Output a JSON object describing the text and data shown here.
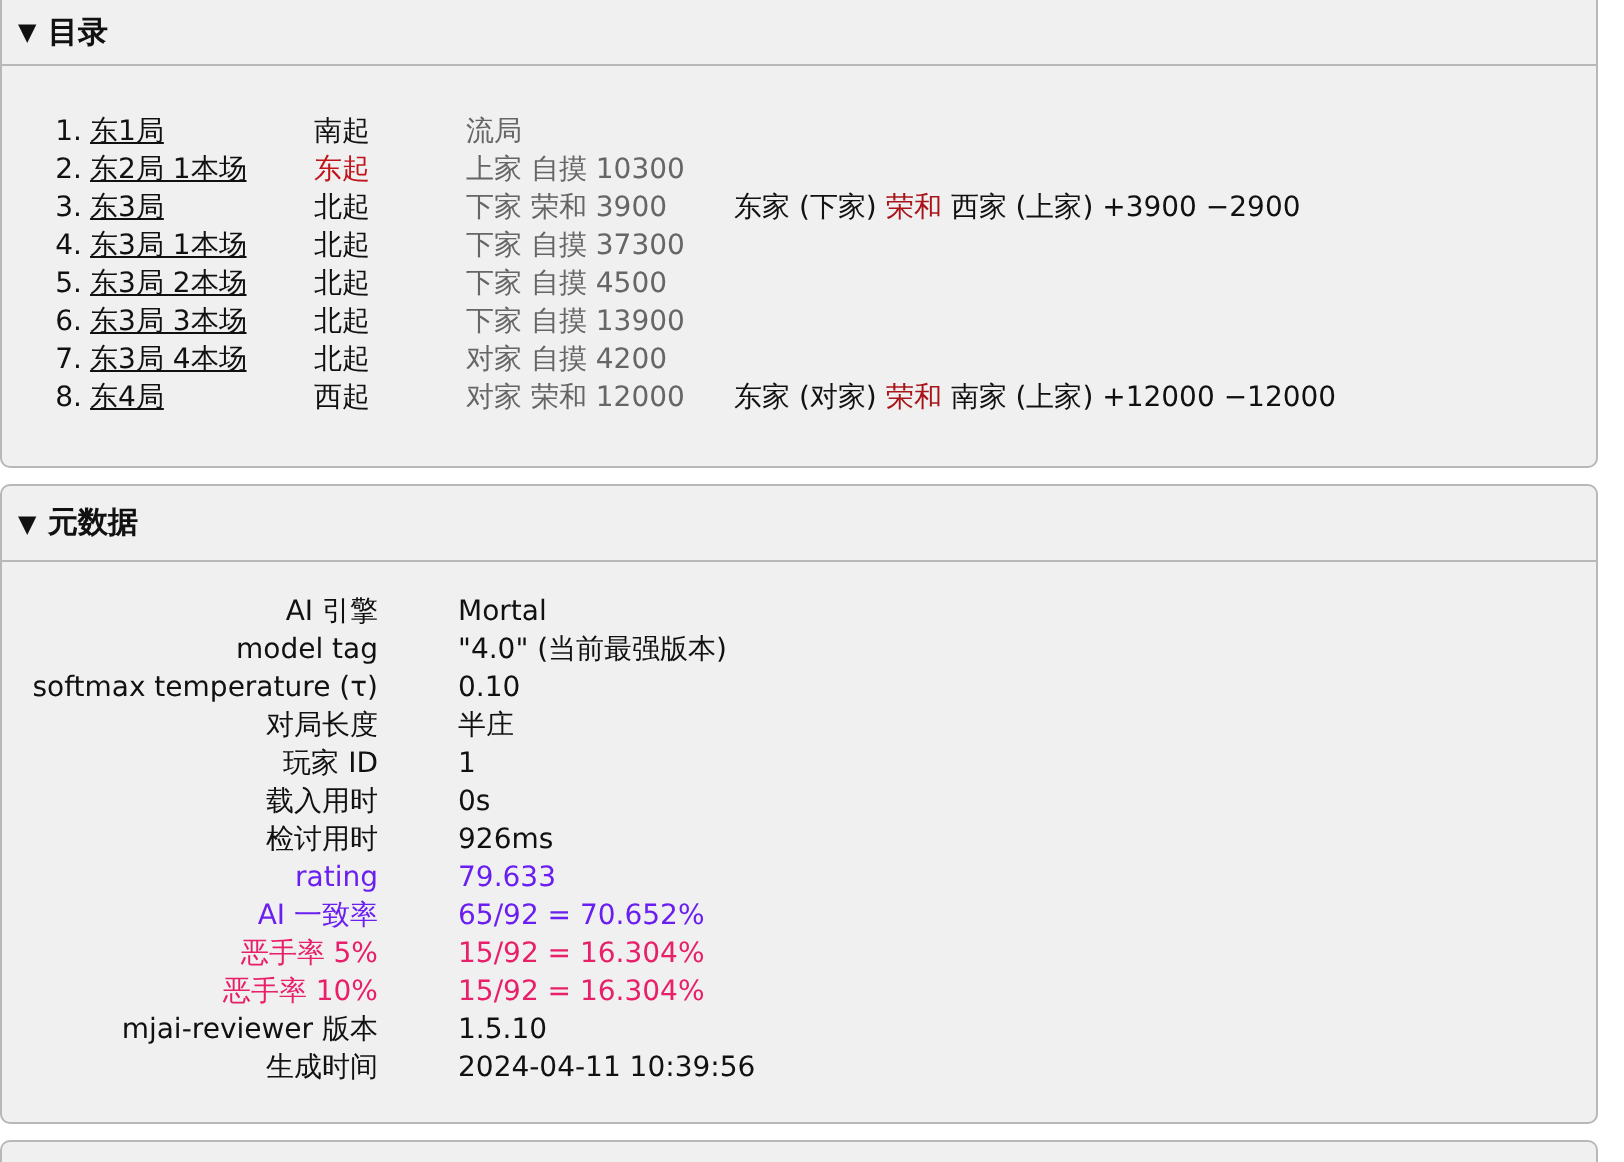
{
  "toc": {
    "toggle": "▼",
    "title": "目录",
    "expanded": true,
    "rounds": [
      {
        "number": "1.",
        "name": "东1局",
        "dealer": "南起",
        "highlighted": false,
        "outcome": "流局"
      },
      {
        "number": "2.",
        "name": "东2局 1本场",
        "dealer": "东起",
        "highlighted": true,
        "outcome": "上家 自摸 10300"
      },
      {
        "number": "3.",
        "name": "东3局",
        "dealer": "北起",
        "highlighted": false,
        "outcome": "下家 荣和 3900",
        "detail": {
          "winner": "东家 (下家)",
          "action": "荣和",
          "loser": "西家 (上家)",
          "delta": "+3900 −2900"
        }
      },
      {
        "number": "4.",
        "name": "东3局 1本场",
        "dealer": "北起",
        "highlighted": false,
        "outcome": "下家 自摸 37300"
      },
      {
        "number": "5.",
        "name": "东3局 2本场",
        "dealer": "北起",
        "highlighted": false,
        "outcome": "下家 自摸 4500"
      },
      {
        "number": "6.",
        "name": "东3局 3本场",
        "dealer": "北起",
        "highlighted": false,
        "outcome": "下家 自摸 13900"
      },
      {
        "number": "7.",
        "name": "东3局 4本场",
        "dealer": "北起",
        "highlighted": false,
        "outcome": "对家 自摸 4200"
      },
      {
        "number": "8.",
        "name": "东4局",
        "dealer": "西起",
        "highlighted": false,
        "outcome": "对家 荣和 12000",
        "detail": {
          "winner": "东家 (对家)",
          "action": "荣和",
          "loser": "南家 (上家)",
          "delta": "+12000 −12000"
        }
      }
    ]
  },
  "metadata": {
    "toggle": "▼",
    "title": "元数据",
    "expanded": true,
    "fields": [
      {
        "label": "AI 引擎",
        "value": "Mortal"
      },
      {
        "label": "model tag",
        "value": "\"4.0\" (当前最强版本)"
      },
      {
        "label": "softmax temperature (τ)",
        "value": "0.10"
      },
      {
        "label": "对局长度",
        "value": "半庄"
      },
      {
        "label": "玩家 ID",
        "value": "1"
      },
      {
        "label": "载入用时",
        "value": "0s"
      },
      {
        "label": "检讨用时",
        "value": "926ms"
      },
      {
        "label": "rating",
        "value": "79.633",
        "color": "#6a1ff0"
      },
      {
        "label": "AI 一致率",
        "value": "65/92 = 70.652%",
        "color": "#6a1ff0"
      },
      {
        "label": "恶手率 5%",
        "value": "15/92 = 16.304%",
        "color": "#e8206a"
      },
      {
        "label": "恶手率 10%",
        "value": "15/92 = 16.304%",
        "color": "#e8206a"
      },
      {
        "label": "mjai-reviewer 版本",
        "value": "1.5.10"
      },
      {
        "label": "生成时间",
        "value": "2024-04-11 10:39:56"
      }
    ]
  }
}
